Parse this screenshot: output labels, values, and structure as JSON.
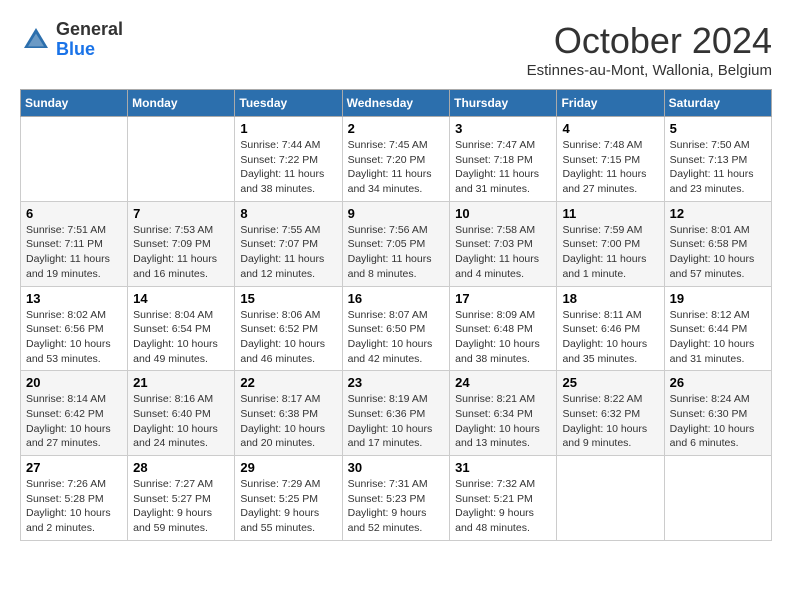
{
  "header": {
    "logo_general": "General",
    "logo_blue": "Blue",
    "month_title": "October 2024",
    "subtitle": "Estinnes-au-Mont, Wallonia, Belgium"
  },
  "weekdays": [
    "Sunday",
    "Monday",
    "Tuesday",
    "Wednesday",
    "Thursday",
    "Friday",
    "Saturday"
  ],
  "weeks": [
    [
      {
        "day": "",
        "info": ""
      },
      {
        "day": "",
        "info": ""
      },
      {
        "day": "1",
        "info": "Sunrise: 7:44 AM\nSunset: 7:22 PM\nDaylight: 11 hours and 38 minutes."
      },
      {
        "day": "2",
        "info": "Sunrise: 7:45 AM\nSunset: 7:20 PM\nDaylight: 11 hours and 34 minutes."
      },
      {
        "day": "3",
        "info": "Sunrise: 7:47 AM\nSunset: 7:18 PM\nDaylight: 11 hours and 31 minutes."
      },
      {
        "day": "4",
        "info": "Sunrise: 7:48 AM\nSunset: 7:15 PM\nDaylight: 11 hours and 27 minutes."
      },
      {
        "day": "5",
        "info": "Sunrise: 7:50 AM\nSunset: 7:13 PM\nDaylight: 11 hours and 23 minutes."
      }
    ],
    [
      {
        "day": "6",
        "info": "Sunrise: 7:51 AM\nSunset: 7:11 PM\nDaylight: 11 hours and 19 minutes."
      },
      {
        "day": "7",
        "info": "Sunrise: 7:53 AM\nSunset: 7:09 PM\nDaylight: 11 hours and 16 minutes."
      },
      {
        "day": "8",
        "info": "Sunrise: 7:55 AM\nSunset: 7:07 PM\nDaylight: 11 hours and 12 minutes."
      },
      {
        "day": "9",
        "info": "Sunrise: 7:56 AM\nSunset: 7:05 PM\nDaylight: 11 hours and 8 minutes."
      },
      {
        "day": "10",
        "info": "Sunrise: 7:58 AM\nSunset: 7:03 PM\nDaylight: 11 hours and 4 minutes."
      },
      {
        "day": "11",
        "info": "Sunrise: 7:59 AM\nSunset: 7:00 PM\nDaylight: 11 hours and 1 minute."
      },
      {
        "day": "12",
        "info": "Sunrise: 8:01 AM\nSunset: 6:58 PM\nDaylight: 10 hours and 57 minutes."
      }
    ],
    [
      {
        "day": "13",
        "info": "Sunrise: 8:02 AM\nSunset: 6:56 PM\nDaylight: 10 hours and 53 minutes."
      },
      {
        "day": "14",
        "info": "Sunrise: 8:04 AM\nSunset: 6:54 PM\nDaylight: 10 hours and 49 minutes."
      },
      {
        "day": "15",
        "info": "Sunrise: 8:06 AM\nSunset: 6:52 PM\nDaylight: 10 hours and 46 minutes."
      },
      {
        "day": "16",
        "info": "Sunrise: 8:07 AM\nSunset: 6:50 PM\nDaylight: 10 hours and 42 minutes."
      },
      {
        "day": "17",
        "info": "Sunrise: 8:09 AM\nSunset: 6:48 PM\nDaylight: 10 hours and 38 minutes."
      },
      {
        "day": "18",
        "info": "Sunrise: 8:11 AM\nSunset: 6:46 PM\nDaylight: 10 hours and 35 minutes."
      },
      {
        "day": "19",
        "info": "Sunrise: 8:12 AM\nSunset: 6:44 PM\nDaylight: 10 hours and 31 minutes."
      }
    ],
    [
      {
        "day": "20",
        "info": "Sunrise: 8:14 AM\nSunset: 6:42 PM\nDaylight: 10 hours and 27 minutes."
      },
      {
        "day": "21",
        "info": "Sunrise: 8:16 AM\nSunset: 6:40 PM\nDaylight: 10 hours and 24 minutes."
      },
      {
        "day": "22",
        "info": "Sunrise: 8:17 AM\nSunset: 6:38 PM\nDaylight: 10 hours and 20 minutes."
      },
      {
        "day": "23",
        "info": "Sunrise: 8:19 AM\nSunset: 6:36 PM\nDaylight: 10 hours and 17 minutes."
      },
      {
        "day": "24",
        "info": "Sunrise: 8:21 AM\nSunset: 6:34 PM\nDaylight: 10 hours and 13 minutes."
      },
      {
        "day": "25",
        "info": "Sunrise: 8:22 AM\nSunset: 6:32 PM\nDaylight: 10 hours and 9 minutes."
      },
      {
        "day": "26",
        "info": "Sunrise: 8:24 AM\nSunset: 6:30 PM\nDaylight: 10 hours and 6 minutes."
      }
    ],
    [
      {
        "day": "27",
        "info": "Sunrise: 7:26 AM\nSunset: 5:28 PM\nDaylight: 10 hours and 2 minutes."
      },
      {
        "day": "28",
        "info": "Sunrise: 7:27 AM\nSunset: 5:27 PM\nDaylight: 9 hours and 59 minutes."
      },
      {
        "day": "29",
        "info": "Sunrise: 7:29 AM\nSunset: 5:25 PM\nDaylight: 9 hours and 55 minutes."
      },
      {
        "day": "30",
        "info": "Sunrise: 7:31 AM\nSunset: 5:23 PM\nDaylight: 9 hours and 52 minutes."
      },
      {
        "day": "31",
        "info": "Sunrise: 7:32 AM\nSunset: 5:21 PM\nDaylight: 9 hours and 48 minutes."
      },
      {
        "day": "",
        "info": ""
      },
      {
        "day": "",
        "info": ""
      }
    ]
  ]
}
